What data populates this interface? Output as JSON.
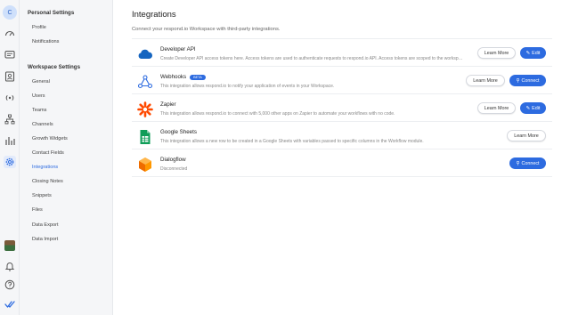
{
  "rail": {
    "avatar_initial": "C"
  },
  "sidebar": {
    "personal_title": "Personal Settings",
    "personal_items": [
      "Profile",
      "Notifications"
    ],
    "workspace_title": "Workspace Settings",
    "workspace_items": [
      "General",
      "Users",
      "Teams",
      "Channels",
      "Growth Widgets",
      "Contact Fields",
      "Integrations",
      "Closing Notes",
      "Snippets",
      "Files",
      "Data Export",
      "Data Import"
    ],
    "selected": "Integrations"
  },
  "main": {
    "title": "Integrations",
    "subtitle": "Connect your respond.io Workspace with third-party integrations.",
    "rows": [
      {
        "name": "Developer API",
        "badge": "",
        "desc": "Create Developer API access tokens here. Access tokens are used to authenticate requests to respond.io API. Access tokens are scoped to the workspace.",
        "learn": "Learn More",
        "action": "Edit"
      },
      {
        "name": "Webhooks",
        "badge": "BETA",
        "desc": "This integration allows respond.io to notify your application of events in your Workspace.",
        "learn": "Learn More",
        "action": "Connect"
      },
      {
        "name": "Zapier",
        "badge": "",
        "desc": "This integration allows respond.io to connect with 5,000 other apps on Zapier to automate your workflows with no code.",
        "learn": "Learn More",
        "action": "Edit"
      },
      {
        "name": "Google Sheets",
        "badge": "",
        "desc": "This integration allows a new row to be created in a Google Sheets with variables passed to specific columns in the Workflow module.",
        "learn": "Learn More",
        "action": ""
      },
      {
        "name": "Dialogflow",
        "badge": "",
        "desc": "Disconnected",
        "learn": "",
        "action": "Connect"
      }
    ]
  },
  "colors": {
    "accent": "#2d6be0",
    "sidebar_bg": "#f5f6f8"
  }
}
